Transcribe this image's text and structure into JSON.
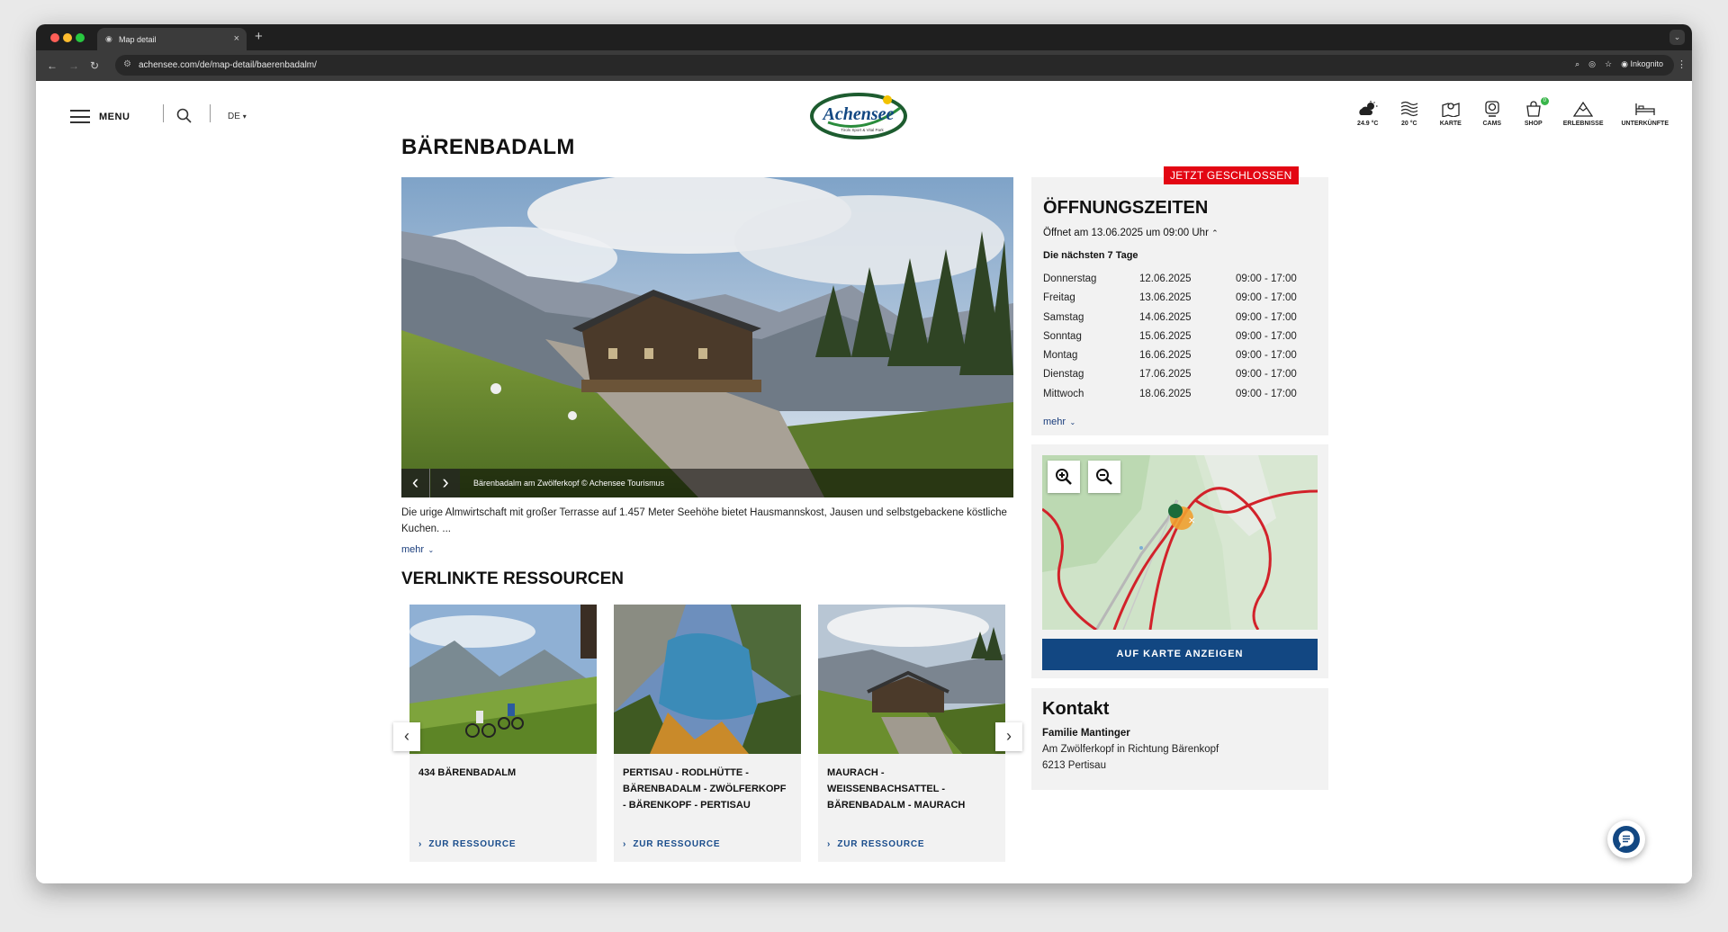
{
  "browser": {
    "tab_title": "Map detail",
    "url": "achensee.com/de/map-detail/baerenbadalm/",
    "incognito_label": "Inkognito"
  },
  "header": {
    "menu_label": "MENU",
    "lang": "DE",
    "logo_text": "Achensee",
    "logo_sub": "Tirols Sport & Vital Park",
    "icons": [
      {
        "icon": "weather-icon",
        "label": "24.9 °C"
      },
      {
        "icon": "water-temp-icon",
        "label": "20 °C"
      },
      {
        "icon": "map-icon",
        "label": "KARTE"
      },
      {
        "icon": "webcam-icon",
        "label": "CAMS"
      },
      {
        "icon": "shop-icon",
        "label": "SHOP",
        "badge": "0"
      },
      {
        "icon": "mountain-icon",
        "label": "ERLEBNISSE"
      },
      {
        "icon": "bed-icon",
        "label": "UNTERKÜNFTE"
      }
    ]
  },
  "main": {
    "title": "BÄRENBADALM",
    "hero_caption": "Bärenbadalm am Zwölferkopf © Achensee Tourismus",
    "description": "Die urige Almwirtschaft mit großer Terrasse auf 1.457 Meter Seehöhe bietet Hausmannskost, Jausen und selbstgebackene köstliche Kuchen. ...",
    "more_label": "mehr"
  },
  "resources": {
    "title": "VERLINKTE RESSOURCEN",
    "link_label": "ZUR RESSOURCE",
    "items": [
      {
        "title": "434 BÄRENBADALM"
      },
      {
        "title": "PERTISAU - RODLHÜTTE - BÄRENBADALM - ZWÖLFERKOPF - BÄRENKOPF - PERTISAU"
      },
      {
        "title": "MAURACH - WEISSENBACHSATTEL - BÄRENBADALM - MAURACH"
      }
    ]
  },
  "hours": {
    "status_badge": "JETZT GESCHLOSSEN",
    "title": "ÖFFNUNGSZEITEN",
    "opens": "Öffnet am 13.06.2025 um 09:00 Uhr",
    "next_days_label": "Die nächsten 7 Tage",
    "rows": [
      {
        "day": "Donnerstag",
        "date": "12.06.2025",
        "time": "09:00 - 17:00"
      },
      {
        "day": "Freitag",
        "date": "13.06.2025",
        "time": "09:00 - 17:00"
      },
      {
        "day": "Samstag",
        "date": "14.06.2025",
        "time": "09:00 - 17:00"
      },
      {
        "day": "Sonntag",
        "date": "15.06.2025",
        "time": "09:00 - 17:00"
      },
      {
        "day": "Montag",
        "date": "16.06.2025",
        "time": "09:00 - 17:00"
      },
      {
        "day": "Dienstag",
        "date": "17.06.2025",
        "time": "09:00 - 17:00"
      },
      {
        "day": "Mittwoch",
        "date": "18.06.2025",
        "time": "09:00 - 17:00"
      }
    ],
    "more_label": "mehr"
  },
  "map": {
    "button_label": "AUF KARTE ANZEIGEN"
  },
  "contact": {
    "title": "Kontakt",
    "name": "Familie Mantinger",
    "address1": "Am Zwölferkopf in Richtung Bärenkopf",
    "address2": "6213 Pertisau"
  },
  "colors": {
    "brand_blue": "#124782",
    "closed_red": "#e30613",
    "panel_bg": "#f2f2f2"
  }
}
